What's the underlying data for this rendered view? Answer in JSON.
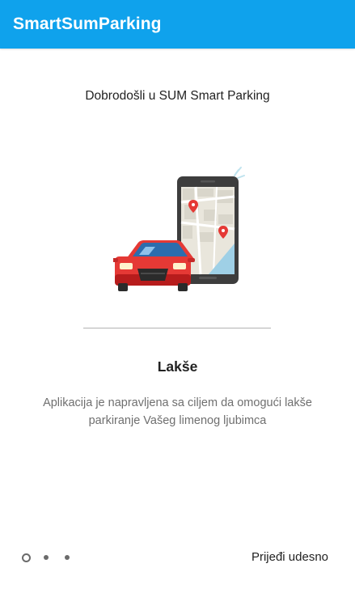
{
  "app": {
    "title": "SmartSumParking"
  },
  "onboarding": {
    "welcome": "Dobrodošli u SUM Smart Parking",
    "illustration": "car-and-phone-map-illustration",
    "feature_title": "Lakše",
    "feature_description": "Aplikacija je napravljena sa ciljem da omogući lakše parkiranje Vašeg limenog ljubimca",
    "next_label": "Prijeđi udesno",
    "page_indicator": {
      "current": 1,
      "total": 3
    }
  },
  "colors": {
    "appbar": "#0fa2ec",
    "car": "#e53935",
    "map_pin": "#e53935",
    "phone": "#3d3d3d"
  }
}
